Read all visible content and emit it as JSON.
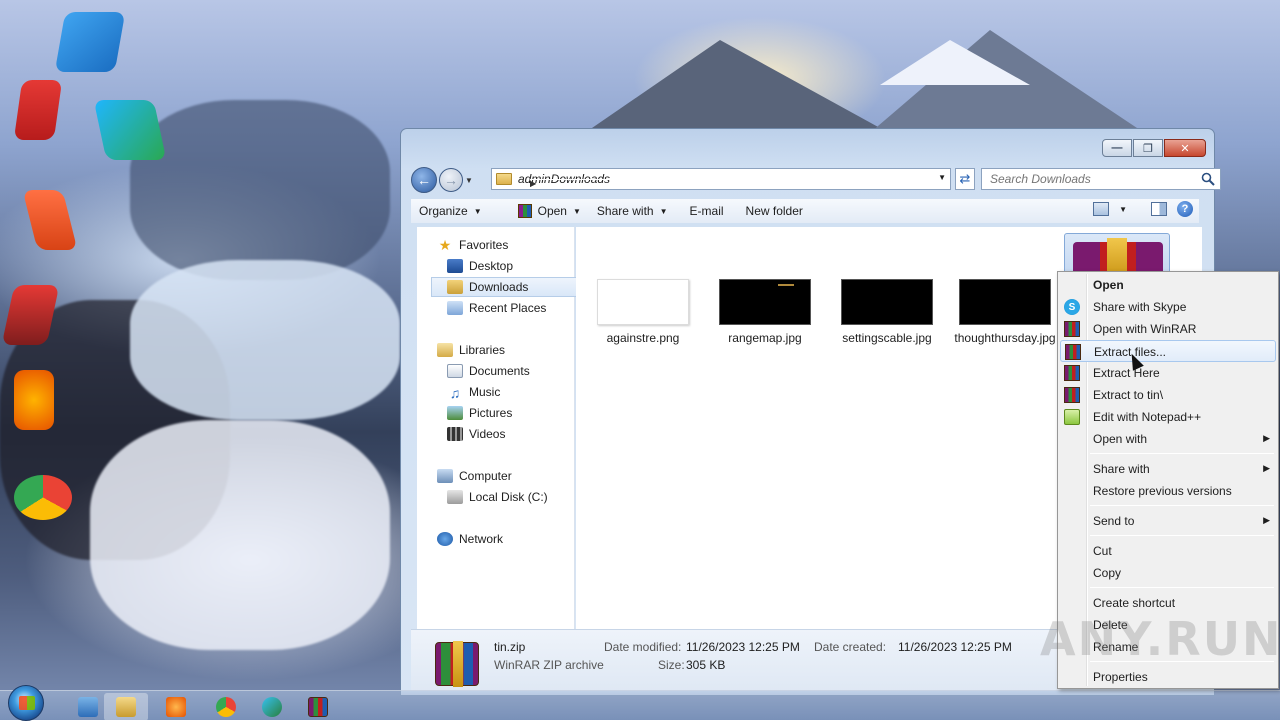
{
  "window": {
    "controls": {
      "minimize": "—",
      "maximize": "❐",
      "close": "✕"
    }
  },
  "address": {
    "crumbs": [
      "admin",
      "Downloads"
    ]
  },
  "search": {
    "placeholder": "Search Downloads"
  },
  "toolbar": {
    "organize": "Organize",
    "open": "Open",
    "share_with": "Share with",
    "email": "E-mail",
    "new_folder": "New folder"
  },
  "nav": {
    "favorites": "Favorites",
    "desktop": "Desktop",
    "downloads": "Downloads",
    "recent_places": "Recent Places",
    "libraries": "Libraries",
    "documents": "Documents",
    "music": "Music",
    "pictures": "Pictures",
    "videos": "Videos",
    "computer": "Computer",
    "local_disk": "Local Disk (C:)",
    "network": "Network"
  },
  "files": [
    {
      "name": "againstre.png"
    },
    {
      "name": "rangemap.jpg"
    },
    {
      "name": "settingscable.jpg"
    },
    {
      "name": "thoughthursday.jpg"
    }
  ],
  "details": {
    "name": "tin.zip",
    "type": "WinRAR ZIP archive",
    "modified_label": "Date modified:",
    "modified_value": "11/26/2023 12:25 PM",
    "size_label": "Size:",
    "size_value": "305 KB",
    "created_label": "Date created:",
    "created_value": "11/26/2023 12:25 PM"
  },
  "context_menu": {
    "open": "Open",
    "share_skype": "Share with Skype",
    "open_winrar": "Open with WinRAR",
    "extract_files": "Extract files...",
    "extract_here": "Extract Here",
    "extract_to": "Extract to tin\\",
    "edit_npp": "Edit with Notepad++",
    "open_with": "Open with",
    "share_with": "Share with",
    "restore": "Restore previous versions",
    "send_to": "Send to",
    "cut": "Cut",
    "copy": "Copy",
    "create_shortcut": "Create shortcut",
    "delete": "Delete",
    "rename": "Rename",
    "properties": "Properties"
  },
  "watermark": "ANY.RUN",
  "colors": {
    "menu_bg": "#f0f0f0",
    "hover_border": "#a8c8ee",
    "window_frame": "#cfdff2"
  }
}
